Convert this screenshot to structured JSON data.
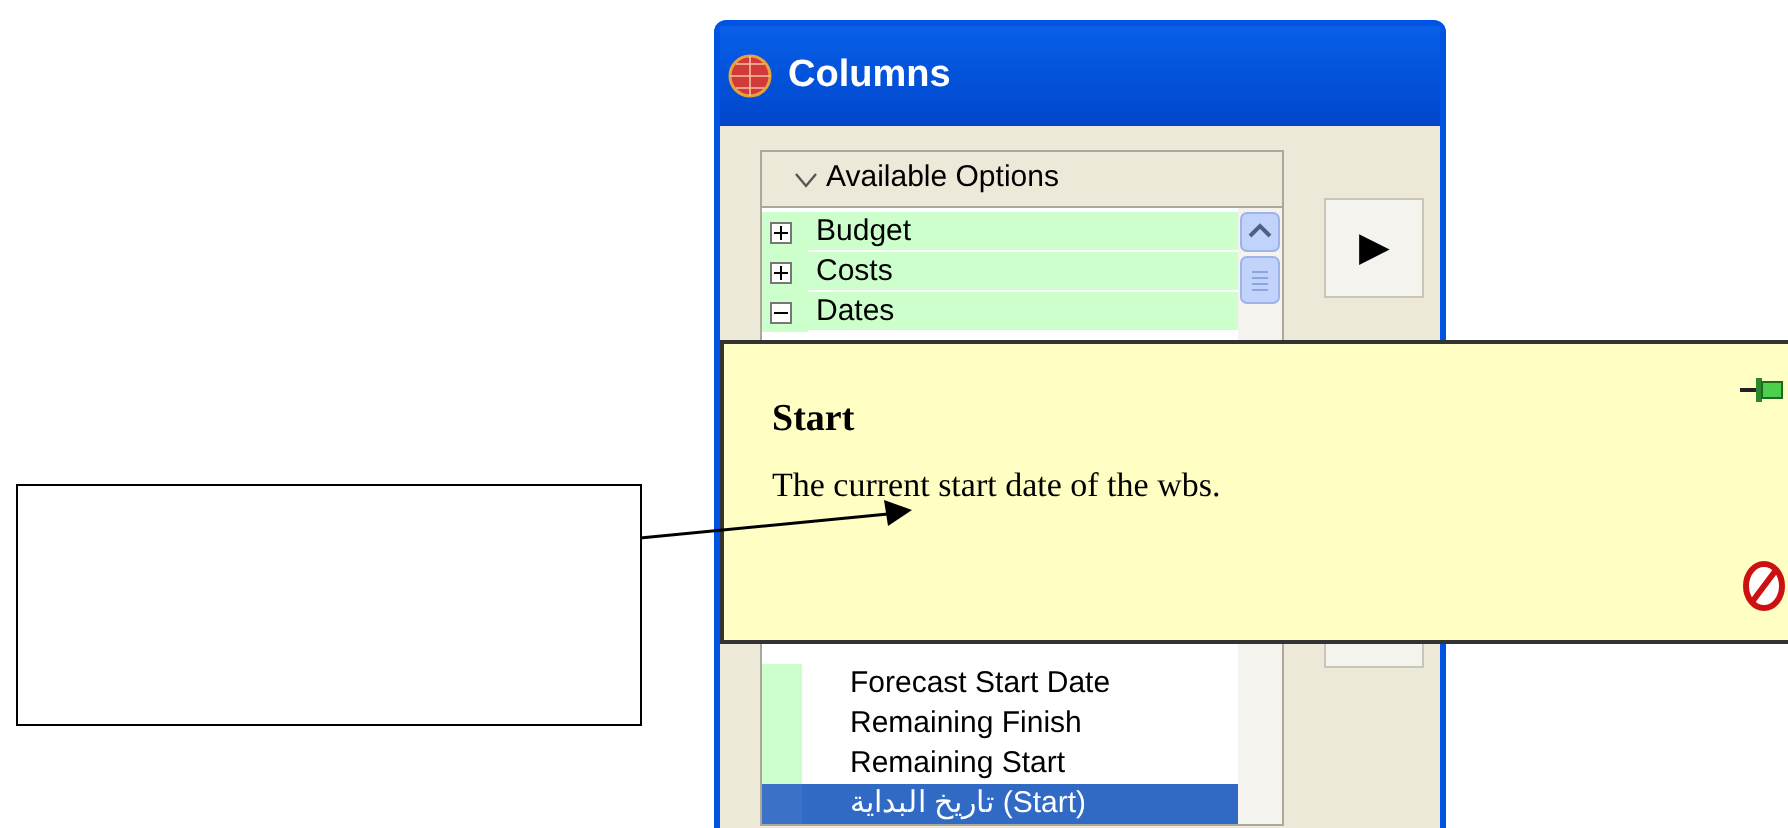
{
  "window": {
    "title": "Columns"
  },
  "available_options": {
    "header": "Available Options",
    "expanded": true,
    "items": [
      {
        "label": "Budget",
        "expanded": false,
        "selected": false
      },
      {
        "label": "Costs",
        "expanded": false,
        "selected": false
      },
      {
        "label": "Dates",
        "expanded": true,
        "selected": false,
        "children": [
          {
            "label": "Forecast Start Date",
            "selected": false
          },
          {
            "label": "Remaining Finish",
            "selected": false
          },
          {
            "label": "Remaining Start",
            "selected": false
          },
          {
            "label": "تاريخ البداية (Start)",
            "selected": true
          }
        ]
      }
    ]
  },
  "add_button": {
    "label": "▶"
  },
  "tooltip": {
    "title": "Start",
    "description": "The current start date of the wbs."
  }
}
